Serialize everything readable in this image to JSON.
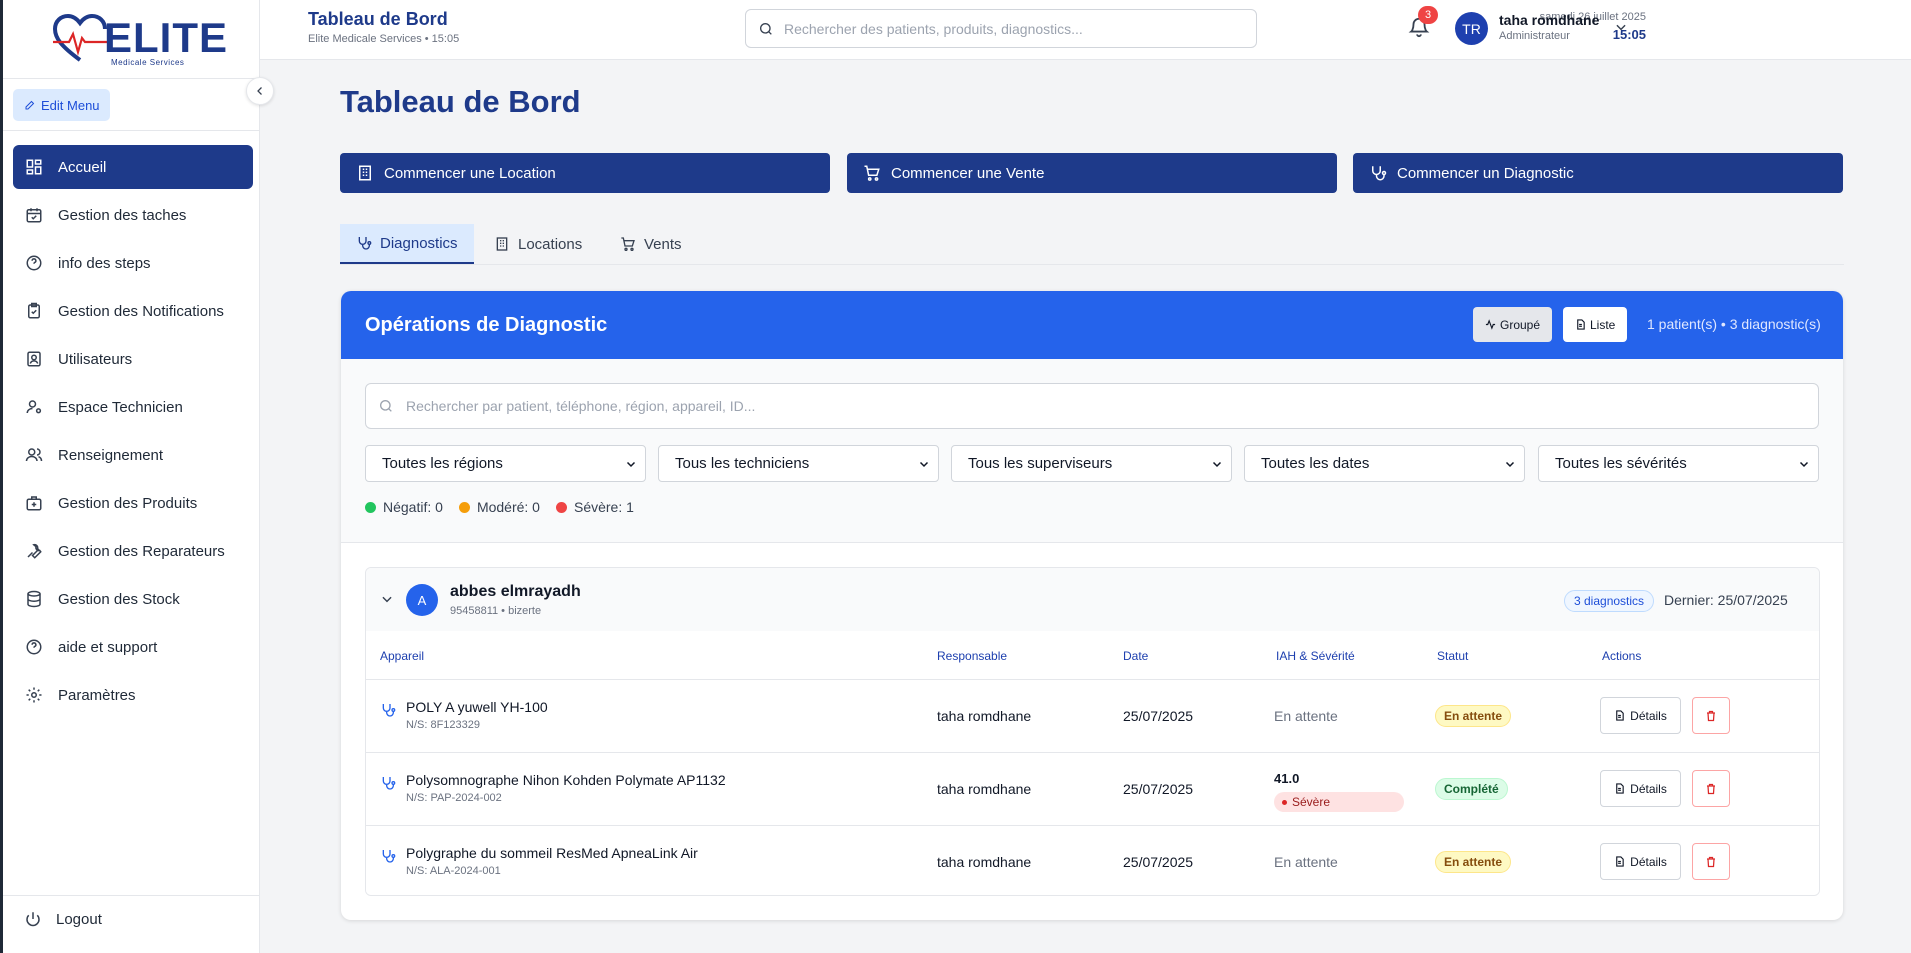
{
  "brand": {
    "name": "ELITE",
    "tagline": "Medicale Services"
  },
  "sidebar": {
    "edit_menu": "Edit Menu",
    "items": [
      {
        "label": "Accueil",
        "icon": "dashboard-icon",
        "active": true
      },
      {
        "label": "Gestion des taches",
        "icon": "calendar-check-icon"
      },
      {
        "label": "info des steps",
        "icon": "help-circle-icon"
      },
      {
        "label": "Gestion des Notifications",
        "icon": "clipboard-check-icon"
      },
      {
        "label": "Utilisateurs",
        "icon": "user-badge-icon"
      },
      {
        "label": "Espace Technicien",
        "icon": "user-cog-icon"
      },
      {
        "label": "Renseignement",
        "icon": "users-icon"
      },
      {
        "label": "Gestion des Produits",
        "icon": "medical-bag-icon"
      },
      {
        "label": "Gestion des Reparateurs",
        "icon": "wrench-icon"
      },
      {
        "label": "Gestion des Stock",
        "icon": "database-icon"
      },
      {
        "label": "aide et support",
        "icon": "help-circle-icon"
      },
      {
        "label": "Paramètres",
        "icon": "gear-icon"
      }
    ],
    "logout": "Logout"
  },
  "topbar": {
    "title": "Tableau de Bord",
    "subtitle": "Elite Medicale Services • 15:05",
    "search_placeholder": "Rechercher des patients, produits, diagnostics...",
    "date": "samedi 26 juillet 2025",
    "time": "15:05",
    "notifications": "3",
    "user_initials": "TR",
    "user_name": "taha romdhane",
    "user_role": "Administrateur"
  },
  "main": {
    "title": "Tableau de Bord",
    "actions": [
      "Commencer une Location",
      "Commencer une Vente",
      "Commencer un Diagnostic"
    ],
    "tabs": [
      {
        "label": "Diagnostics",
        "icon": "stethoscope-icon",
        "active": true
      },
      {
        "label": "Locations",
        "icon": "building-icon"
      },
      {
        "label": "Vents",
        "icon": "cart-icon"
      }
    ]
  },
  "ops": {
    "title": "Opérations de Diagnostic",
    "view_grouped": "Groupé",
    "view_list": "Liste",
    "count": "1 patient(s) • 3 diagnostic(s)",
    "search_placeholder": "Rechercher par patient, téléphone, région, appareil, ID...",
    "filters": [
      "Toutes les régions",
      "Tous les techniciens",
      "Tous les superviseurs",
      "Toutes les dates",
      "Toutes les sévérités"
    ],
    "legend": [
      {
        "label": "Négatif: 0",
        "color": "#22c55e"
      },
      {
        "label": "Modéré: 0",
        "color": "#f59e0b"
      },
      {
        "label": "Sévère: 1",
        "color": "#ef4444"
      }
    ],
    "patient": {
      "initial": "A",
      "name": "abbes elmrayadh",
      "info": "95458811 • bizerte",
      "badge": "3 diagnostics",
      "last": "Dernier: 25/07/2025"
    },
    "columns": [
      "Appareil",
      "Responsable",
      "Date",
      "IAH & Sévérité",
      "Statut",
      "Actions"
    ],
    "rows": [
      {
        "device": "POLY A yuwell YH-100",
        "sn": "N/S: 8F123329",
        "responsible": "taha romdhane",
        "date": "25/07/2025",
        "iah": "En attente",
        "status": "En attente",
        "details": "Détails"
      },
      {
        "device": "Polysomnographe Nihon Kohden Polymate AP1132",
        "sn": "N/S: PAP-2024-002",
        "responsible": "taha romdhane",
        "date": "25/07/2025",
        "iah_value": "41.0",
        "severity": "Sévère",
        "status": "Complété",
        "details": "Détails"
      },
      {
        "device": "Polygraphe du sommeil ResMed ApneaLink Air",
        "sn": "N/S: ALA-2024-001",
        "responsible": "taha romdhane",
        "date": "25/07/2025",
        "iah": "En attente",
        "status": "En attente",
        "details": "Détails"
      }
    ]
  }
}
